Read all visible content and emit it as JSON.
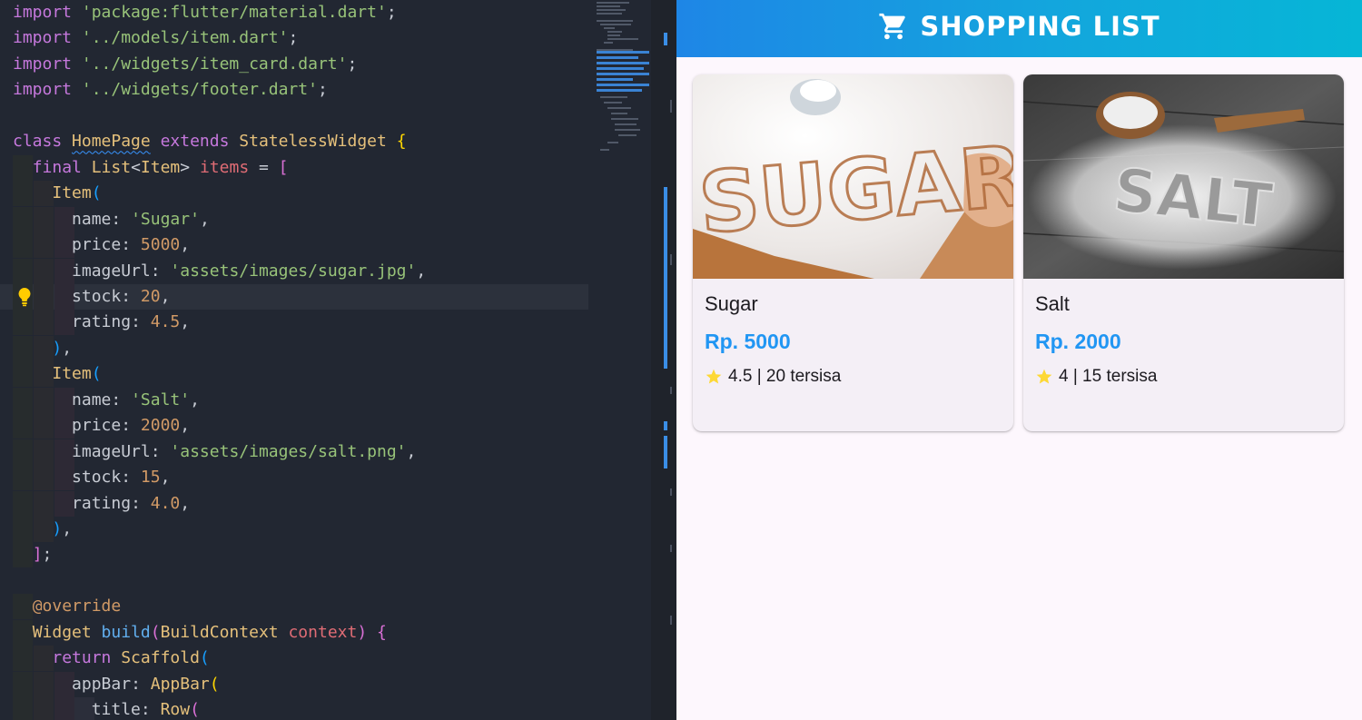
{
  "editor": {
    "language": "dart",
    "lines": [
      [
        [
          "import ",
          "k-imp"
        ],
        [
          "'package:flutter/material.dart'",
          "k-str"
        ],
        [
          ";",
          "k-pun"
        ]
      ],
      [
        [
          "import ",
          "k-imp"
        ],
        [
          "'../models/item.dart'",
          "k-str"
        ],
        [
          ";",
          "k-pun"
        ]
      ],
      [
        [
          "import ",
          "k-imp"
        ],
        [
          "'../widgets/item_card.dart'",
          "k-str"
        ],
        [
          ";",
          "k-pun"
        ]
      ],
      [
        [
          "import ",
          "k-imp"
        ],
        [
          "'../widgets/footer.dart'",
          "k-str"
        ],
        [
          ";",
          "k-pun"
        ]
      ],
      [],
      [
        [
          "class ",
          "k-kw"
        ],
        [
          "HomePage",
          "k-cls squig"
        ],
        [
          " extends ",
          "k-kw"
        ],
        [
          "StatelessWidget",
          "k-cls"
        ],
        [
          " ",
          "k-pun"
        ],
        [
          "{",
          "k-br1"
        ]
      ],
      [
        [
          "  ",
          "k-pun"
        ],
        [
          "final ",
          "k-kw"
        ],
        [
          "List",
          "k-cls"
        ],
        [
          "<",
          "k-pun"
        ],
        [
          "Item",
          "k-cls"
        ],
        [
          "> ",
          "k-pun"
        ],
        [
          "items",
          "k-prop"
        ],
        [
          " = ",
          "k-pun"
        ],
        [
          "[",
          "k-br2"
        ]
      ],
      [
        [
          "    ",
          "k-pun"
        ],
        [
          "Item",
          "k-cls"
        ],
        [
          "(",
          "k-br3"
        ]
      ],
      [
        [
          "      ",
          "k-pun"
        ],
        [
          "name",
          "k-pun"
        ],
        [
          ": ",
          "k-pun"
        ],
        [
          "'Sugar'",
          "k-str"
        ],
        [
          ",",
          "k-pun"
        ]
      ],
      [
        [
          "      ",
          "k-pun"
        ],
        [
          "price",
          "k-pun"
        ],
        [
          ": ",
          "k-pun"
        ],
        [
          "5000",
          "k-num"
        ],
        [
          ",",
          "k-pun"
        ]
      ],
      [
        [
          "      ",
          "k-pun"
        ],
        [
          "imageUrl",
          "k-pun"
        ],
        [
          ": ",
          "k-pun"
        ],
        [
          "'assets/images/sugar.jpg'",
          "k-str"
        ],
        [
          ",",
          "k-pun"
        ]
      ],
      [
        [
          "      ",
          "k-pun"
        ],
        [
          "stock",
          "k-pun"
        ],
        [
          ": ",
          "k-pun"
        ],
        [
          "20",
          "k-num"
        ],
        [
          ",",
          "k-pun"
        ]
      ],
      [
        [
          "      ",
          "k-pun"
        ],
        [
          "rating",
          "k-pun"
        ],
        [
          ": ",
          "k-pun"
        ],
        [
          "4.5",
          "k-num"
        ],
        [
          ",",
          "k-pun"
        ]
      ],
      [
        [
          "    ",
          "k-pun"
        ],
        [
          ")",
          "k-br3"
        ],
        [
          ",",
          "k-pun"
        ]
      ],
      [
        [
          "    ",
          "k-pun"
        ],
        [
          "Item",
          "k-cls"
        ],
        [
          "(",
          "k-br3"
        ]
      ],
      [
        [
          "      ",
          "k-pun"
        ],
        [
          "name",
          "k-pun"
        ],
        [
          ": ",
          "k-pun"
        ],
        [
          "'Salt'",
          "k-str"
        ],
        [
          ",",
          "k-pun"
        ]
      ],
      [
        [
          "      ",
          "k-pun"
        ],
        [
          "price",
          "k-pun"
        ],
        [
          ": ",
          "k-pun"
        ],
        [
          "2000",
          "k-num"
        ],
        [
          ",",
          "k-pun"
        ]
      ],
      [
        [
          "      ",
          "k-pun"
        ],
        [
          "imageUrl",
          "k-pun"
        ],
        [
          ": ",
          "k-pun"
        ],
        [
          "'assets/images/salt.png'",
          "k-str"
        ],
        [
          ",",
          "k-pun"
        ]
      ],
      [
        [
          "      ",
          "k-pun"
        ],
        [
          "stock",
          "k-pun"
        ],
        [
          ": ",
          "k-pun"
        ],
        [
          "15",
          "k-num"
        ],
        [
          ",",
          "k-pun"
        ]
      ],
      [
        [
          "      ",
          "k-pun"
        ],
        [
          "rating",
          "k-pun"
        ],
        [
          ": ",
          "k-pun"
        ],
        [
          "4.0",
          "k-num"
        ],
        [
          ",",
          "k-pun"
        ]
      ],
      [
        [
          "    ",
          "k-pun"
        ],
        [
          ")",
          "k-br3"
        ],
        [
          ",",
          "k-pun"
        ]
      ],
      [
        [
          "  ",
          "k-pun"
        ],
        [
          "]",
          "k-br2"
        ],
        [
          ";",
          "k-pun"
        ]
      ],
      [],
      [
        [
          "  ",
          "k-pun"
        ],
        [
          "@override",
          "k-ann"
        ]
      ],
      [
        [
          "  ",
          "k-pun"
        ],
        [
          "Widget ",
          "k-cls"
        ],
        [
          "build",
          "k-fn"
        ],
        [
          "(",
          "k-br2"
        ],
        [
          "BuildContext ",
          "k-cls"
        ],
        [
          "context",
          "k-prop"
        ],
        [
          ")",
          "k-br2"
        ],
        [
          " ",
          "k-pun"
        ],
        [
          "{",
          "k-br2"
        ]
      ],
      [
        [
          "    ",
          "k-pun"
        ],
        [
          "return ",
          "k-kw"
        ],
        [
          "Scaffold",
          "k-cls"
        ],
        [
          "(",
          "k-br3"
        ]
      ],
      [
        [
          "      ",
          "k-pun"
        ],
        [
          "appBar",
          "k-pun"
        ],
        [
          ": ",
          "k-pun"
        ],
        [
          "AppBar",
          "k-cls"
        ],
        [
          "(",
          "k-br1"
        ]
      ],
      [
        [
          "        ",
          "k-pun"
        ],
        [
          "title",
          "k-pun"
        ],
        [
          ": ",
          "k-pun"
        ],
        [
          "Row",
          "k-cls"
        ],
        [
          "(",
          "k-br2"
        ]
      ]
    ]
  },
  "app": {
    "title": "SHOPPING LIST",
    "title_icon": "shopping-cart-icon",
    "brand_colors": {
      "appbar_start": "#1e86e6",
      "appbar_end": "#06b6d6",
      "price": "#2196f3",
      "star": "#fdd835"
    },
    "items": [
      {
        "name": "Sugar",
        "price": "Rp. 5000",
        "rating": "4.5",
        "stock_text": "20 tersisa",
        "meta": "4.5 | 20 tersisa",
        "image": "SUGAR"
      },
      {
        "name": "Salt",
        "price": "Rp. 2000",
        "rating": "4",
        "stock_text": "15 tersisa",
        "meta": "4 | 15 tersisa",
        "image": "SALT"
      }
    ]
  }
}
